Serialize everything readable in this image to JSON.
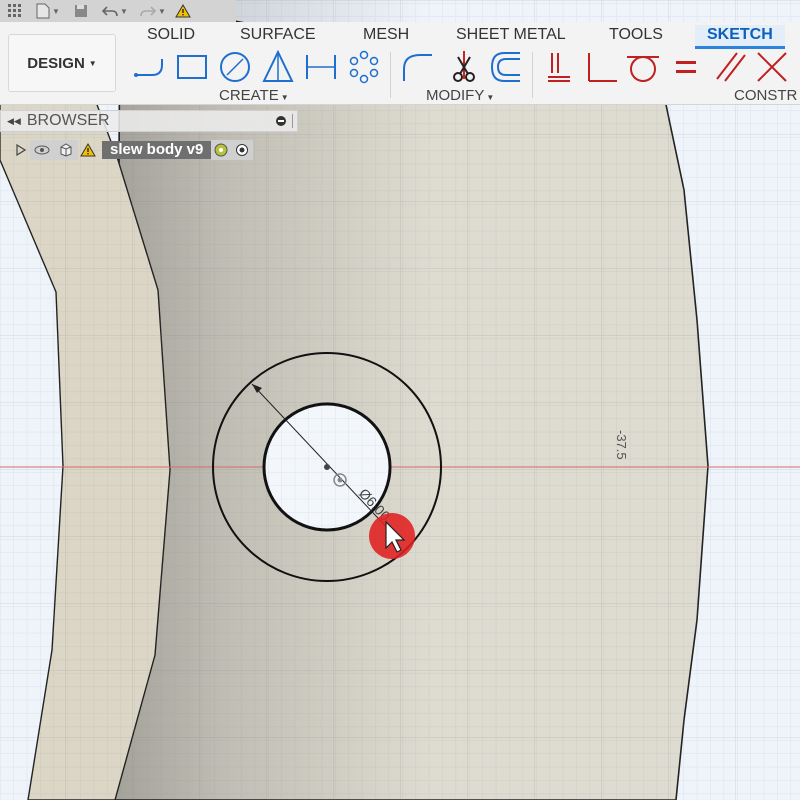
{
  "tabs": [
    {
      "label": "SOLID"
    },
    {
      "label": "SURFACE"
    },
    {
      "label": "MESH"
    },
    {
      "label": "SHEET METAL"
    },
    {
      "label": "TOOLS"
    },
    {
      "label": "SKETCH"
    }
  ],
  "workspace": {
    "label": "DESIGN"
  },
  "groups": {
    "create": "CREATE",
    "modify": "MODIFY",
    "constraints": "CONSTR"
  },
  "browser": {
    "title": "BROWSER",
    "component": "slew body v9"
  },
  "sketch": {
    "diameter_label": "Ø6.00",
    "dimension_label": "-37.5"
  },
  "colors": {
    "accent": "#0a5fbf",
    "body": "#dedad0",
    "inner_face": "#ccc8ba",
    "cursor_highlight": "#e02020",
    "axis_red": "#d86a6a"
  },
  "icons": [
    "grid-icon",
    "file-icon",
    "save-icon",
    "undo-icon",
    "redo-icon",
    "warning-icon",
    "line-icon",
    "rectangle-icon",
    "circle-icon",
    "triangle-icon",
    "dimension-icon",
    "pattern-icon",
    "fillet-icon",
    "trim-icon",
    "offset-icon",
    "coincident-constraint-icon",
    "perpendicular-icon",
    "tangent-icon",
    "equal-icon",
    "parallel-icon",
    "midpoint-icon",
    "eye-icon",
    "component-icon",
    "radio-icon",
    "cursor-icon"
  ]
}
